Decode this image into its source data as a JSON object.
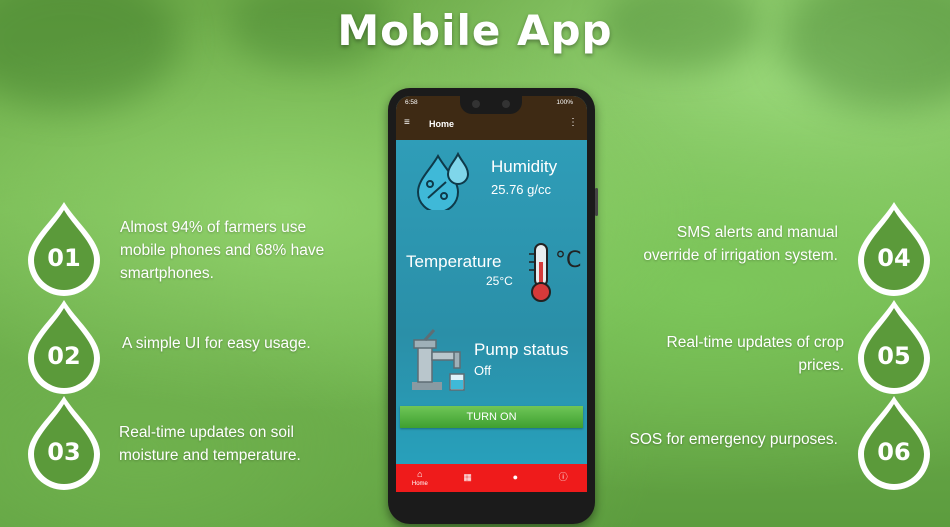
{
  "title": "Mobile App",
  "features_left": [
    {
      "num": "01",
      "text_lines": [
        "Almost 94% of farmers use",
        "mobile phones and 68% have",
        "smartphones."
      ]
    },
    {
      "num": "02",
      "text_lines": [
        "A simple UI for easy usage."
      ]
    },
    {
      "num": "03",
      "text_lines": [
        "Real-time updates on soil",
        "moisture and temperature."
      ]
    }
  ],
  "features_right": [
    {
      "num": "04",
      "text_lines": [
        "SMS alerts and manual",
        "override of irrigation system."
      ]
    },
    {
      "num": "05",
      "text_lines": [
        "Real-time updates of crop",
        "prices."
      ]
    },
    {
      "num": "06",
      "text_lines": [
        "SOS for emergency purposes."
      ]
    }
  ],
  "phone": {
    "status_time": "6:58",
    "battery": "100%",
    "app_title": "Home",
    "humidity_label": "Humidity",
    "humidity_value": "25.76 g/cc",
    "temperature_label": "Temperature",
    "temperature_value": "25°C",
    "temperature_unit_icon": "°C",
    "pump_label": "Pump status",
    "pump_value": "Off",
    "turn_on_label": "TURN ON",
    "nav": [
      {
        "icon": "home-icon",
        "label": "Home"
      },
      {
        "icon": "dashboard-icon",
        "label": ""
      },
      {
        "icon": "person-icon",
        "label": ""
      },
      {
        "icon": "info-icon",
        "label": ""
      }
    ]
  },
  "colors": {
    "drop_fill": "#5b9a3a",
    "appbar": "#3e2a14",
    "screen": "#2f9db8",
    "bottom_nav": "#ef1b1b",
    "button": "#4aaa3a"
  }
}
